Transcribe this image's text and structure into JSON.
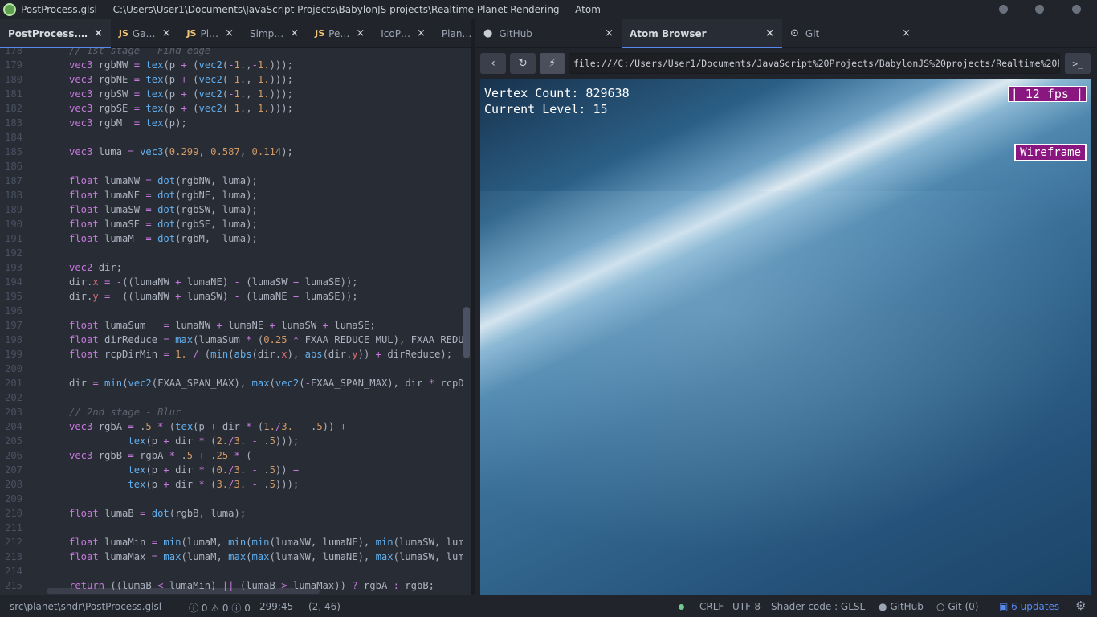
{
  "window": {
    "title": "PostProcess.glsl — C:\\Users\\User1\\Documents\\JavaScript Projects\\BabylonJS projects\\Realtime Planet Rendering — Atom"
  },
  "editor_tabs": [
    {
      "label": "PostProcess.…",
      "js": "",
      "active": true
    },
    {
      "label": "Ga…",
      "js": "JS",
      "active": false
    },
    {
      "label": "Pl…",
      "js": "JS",
      "active": false
    },
    {
      "label": "Simp…",
      "js": "",
      "active": false
    },
    {
      "label": "Pe…",
      "js": "JS",
      "active": false
    },
    {
      "label": "IcoP…",
      "js": "",
      "active": false
    },
    {
      "label": "Plan…",
      "js": "",
      "active": false
    }
  ],
  "dock_tabs": [
    {
      "label": "GitHub",
      "icon": "github-icon",
      "active": false
    },
    {
      "label": "Atom Browser",
      "icon": "",
      "active": true
    },
    {
      "label": "Git",
      "icon": "git-commit-icon",
      "active": false
    }
  ],
  "code_lines": [
    {
      "n": "178",
      "t": "    // 1st stage - Find edge"
    },
    {
      "n": "179",
      "t": "    vec3 rgbNW = tex(p + (vec2(-1.,-1.)));"
    },
    {
      "n": "180",
      "t": "    vec3 rgbNE = tex(p + (vec2( 1.,-1.)));"
    },
    {
      "n": "181",
      "t": "    vec3 rgbSW = tex(p + (vec2(-1., 1.)));"
    },
    {
      "n": "182",
      "t": "    vec3 rgbSE = tex(p + (vec2( 1., 1.)));"
    },
    {
      "n": "183",
      "t": "    vec3 rgbM  = tex(p);"
    },
    {
      "n": "184",
      "t": ""
    },
    {
      "n": "185",
      "t": "    vec3 luma = vec3(0.299, 0.587, 0.114);"
    },
    {
      "n": "186",
      "t": ""
    },
    {
      "n": "187",
      "t": "    float lumaNW = dot(rgbNW, luma);"
    },
    {
      "n": "188",
      "t": "    float lumaNE = dot(rgbNE, luma);"
    },
    {
      "n": "189",
      "t": "    float lumaSW = dot(rgbSW, luma);"
    },
    {
      "n": "190",
      "t": "    float lumaSE = dot(rgbSE, luma);"
    },
    {
      "n": "191",
      "t": "    float lumaM  = dot(rgbM,  luma);"
    },
    {
      "n": "192",
      "t": ""
    },
    {
      "n": "193",
      "t": "    vec2 dir;"
    },
    {
      "n": "194",
      "t": "    dir.x = -((lumaNW + lumaNE) - (lumaSW + lumaSE));"
    },
    {
      "n": "195",
      "t": "    dir.y =  ((lumaNW + lumaSW) - (lumaNE + lumaSE));"
    },
    {
      "n": "196",
      "t": ""
    },
    {
      "n": "197",
      "t": "    float lumaSum   = lumaNW + lumaNE + lumaSW + lumaSE;"
    },
    {
      "n": "198",
      "t": "    float dirReduce = max(lumaSum * (0.25 * FXAA_REDUCE_MUL), FXAA_REDUC"
    },
    {
      "n": "199",
      "t": "    float rcpDirMin = 1. / (min(abs(dir.x), abs(dir.y)) + dirReduce);"
    },
    {
      "n": "200",
      "t": ""
    },
    {
      "n": "201",
      "t": "    dir = min(vec2(FXAA_SPAN_MAX), max(vec2(-FXAA_SPAN_MAX), dir * rcpDi"
    },
    {
      "n": "202",
      "t": ""
    },
    {
      "n": "203",
      "t": "    // 2nd stage - Blur"
    },
    {
      "n": "204",
      "t": "    vec3 rgbA = .5 * (tex(p + dir * (1./3. - .5)) +"
    },
    {
      "n": "205",
      "t": "              tex(p + dir * (2./3. - .5)));"
    },
    {
      "n": "206",
      "t": "    vec3 rgbB = rgbA * .5 + .25 * ("
    },
    {
      "n": "207",
      "t": "              tex(p + dir * (0./3. - .5)) +"
    },
    {
      "n": "208",
      "t": "              tex(p + dir * (3./3. - .5)));"
    },
    {
      "n": "209",
      "t": ""
    },
    {
      "n": "210",
      "t": "    float lumaB = dot(rgbB, luma);"
    },
    {
      "n": "211",
      "t": ""
    },
    {
      "n": "212",
      "t": "    float lumaMin = min(lumaM, min(min(lumaNW, lumaNE), min(lumaSW, luma"
    },
    {
      "n": "213",
      "t": "    float lumaMax = max(lumaM, max(max(lumaNW, lumaNE), max(lumaSW, luma"
    },
    {
      "n": "214",
      "t": ""
    },
    {
      "n": "215",
      "t": "    return ((lumaB < lumaMin) || (lumaB > lumaMax)) ? rgbA : rgbB;"
    }
  ],
  "browser": {
    "url": "file:///C:/Users/User1/Documents/JavaScript%20Projects/BabylonJS%20projects/Realtime%20Planet",
    "vertex_count": "Vertex Count: 829638",
    "current_level": "Current Level: 15",
    "fps": "| 12 fps |",
    "wireframe": "Wireframe"
  },
  "status": {
    "path": "src\\planet\\shdr\\PostProcess.glsl",
    "errors": "0",
    "warnings": "0",
    "infos": "0",
    "cursor": "299:45",
    "selection": "(2, 46)",
    "line_ending": "CRLF",
    "encoding": "UTF-8",
    "grammar": "Shader code : GLSL",
    "github": "GitHub",
    "git": "Git (0)",
    "updates": "6 updates"
  },
  "colors": {
    "accent": "#568af2",
    "hud_button": "#8a1780",
    "editor_bg": "#282c34"
  }
}
